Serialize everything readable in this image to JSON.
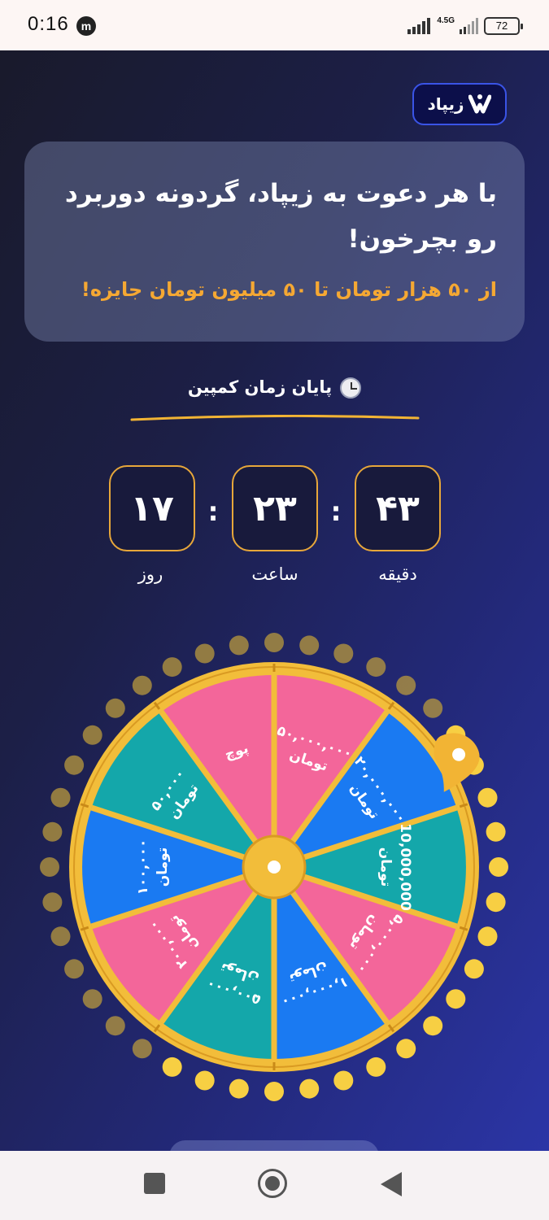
{
  "status_bar": {
    "time": "0:16",
    "app_icon_letter": "m",
    "network": "4.5G",
    "battery": "72"
  },
  "logo": {
    "text": "زیپاد"
  },
  "headline": {
    "title": "با هر دعوت به زیپاد، گردونه دوربرد رو بچرخون!",
    "subtitle": "از ۵۰ هزار تومان تا ۵۰ میلیون تومان جایزه!"
  },
  "campaign": {
    "label": "پایان زمان کمپین"
  },
  "countdown": {
    "separator": ":",
    "days": {
      "value": "۱۷",
      "label": "روز"
    },
    "hours": {
      "value": "۲۳",
      "label": "ساعت"
    },
    "minutes": {
      "value": "۴۳",
      "label": "دقیقه"
    }
  },
  "wheel": {
    "segments": [
      {
        "line1": "۵۰,۰۰۰,۰۰۰",
        "line2": "تومان",
        "color": "#f3669a"
      },
      {
        "line1": "۲۰,۰۰۰,۰۰۰",
        "line2": "تومان",
        "color": "#1a7af2"
      },
      {
        "line1": "10,000,000",
        "line2": "تومان",
        "color": "#14a7aa"
      },
      {
        "line1": "۵,۰۰۰,۰۰۰",
        "line2": "تومان",
        "color": "#f3669a"
      },
      {
        "line1": "۱,۰۰۰,۰۰۰",
        "line2": "تومان",
        "color": "#1a7af2"
      },
      {
        "line1": "۵۰۰,۰۰۰",
        "line2": "تومان",
        "color": "#14a7aa"
      },
      {
        "line1": "۲۰۰,۰۰۰",
        "line2": "تومان",
        "color": "#f3669a"
      },
      {
        "line1": "۱۰۰,۰۰۰",
        "line2": "تومان",
        "color": "#1a7af2"
      },
      {
        "line1": "۵۰,۰۰۰",
        "line2": "تومان",
        "color": "#14a7aa"
      },
      {
        "line1": "پوچ",
        "line2": "",
        "color": "#f3669a"
      }
    ],
    "rim_color": "#f2bd3a",
    "pointer_color": "#f2b434"
  }
}
